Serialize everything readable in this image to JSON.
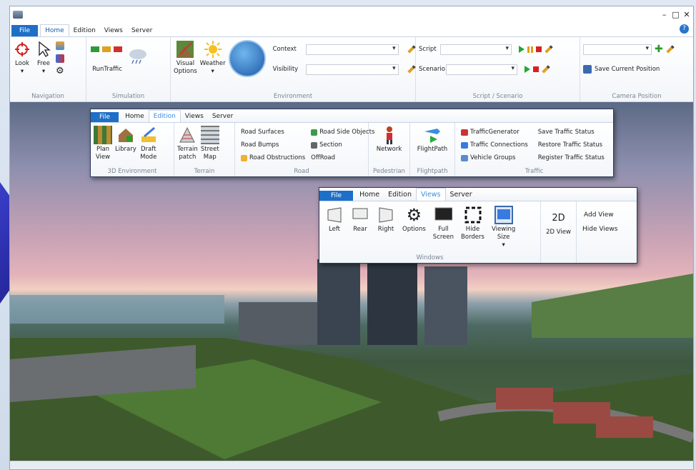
{
  "window": {
    "controls": [
      "–",
      "□",
      "✕"
    ]
  },
  "menu": {
    "file": "File",
    "tabs": [
      "Home",
      "Edition",
      "Views",
      "Server"
    ],
    "help": "?"
  },
  "ribbon": {
    "navigation": {
      "label": "Navigation",
      "look": "Look",
      "free": "Free"
    },
    "simulation": {
      "label": "Simulation",
      "run_traffic": "RunTraffic"
    },
    "environment": {
      "label": "Environment",
      "visual_options": [
        "Visual",
        "Options"
      ],
      "weather": "Weather",
      "context_label": "Context",
      "visibility_label": "Visibility"
    },
    "script_scenario": {
      "label": "Script / Scenario",
      "script_label": "Script",
      "scenario_label": "Scenario"
    },
    "camera": {
      "label": "Camera Position",
      "save": "Save Current Position"
    }
  },
  "edition_panel": {
    "tabs": [
      "File",
      "Home",
      "Edition",
      "Views",
      "Server"
    ],
    "env3d": {
      "label": "3D Environment",
      "plan_view": [
        "Plan",
        "View"
      ],
      "library": "Library",
      "draft_mode": [
        "Draft",
        "Mode"
      ]
    },
    "terrain": {
      "label": "Terrain",
      "terrain_patch": [
        "Terrain",
        "patch"
      ],
      "street_map": [
        "Street",
        "Map"
      ]
    },
    "road": {
      "label": "Road",
      "items": [
        "Road Surfaces",
        "Road Bumps",
        "Road Obstructions"
      ],
      "items2": [
        "Road Side Objects",
        "Section",
        "OffRoad"
      ]
    },
    "pedestrian": {
      "label": "Pedestrian",
      "network": "Network"
    },
    "flightpath": {
      "label": "Flightpath",
      "flightpath": "FlightPath"
    },
    "traffic": {
      "label": "Traffic",
      "items": [
        "TrafficGenerator",
        "Traffic Connections",
        "Vehicle Groups"
      ],
      "items2": [
        "Save Traffic Status",
        "Restore Traffic Status",
        "Register Traffic Status"
      ]
    }
  },
  "views_panel": {
    "tabs": [
      "File",
      "Home",
      "Edition",
      "Views",
      "Server"
    ],
    "buttons": [
      "Left",
      "Rear",
      "Right",
      "Options"
    ],
    "full_screen": [
      "Full",
      "Screen"
    ],
    "hide_borders": [
      "Hide",
      "Borders"
    ],
    "viewing_size": [
      "Viewing",
      "Size"
    ],
    "windows_label": "Windows",
    "view2d": "2D View",
    "view2d_icon": "2D",
    "add_view": "Add View",
    "hide_views": "Hide Views"
  }
}
